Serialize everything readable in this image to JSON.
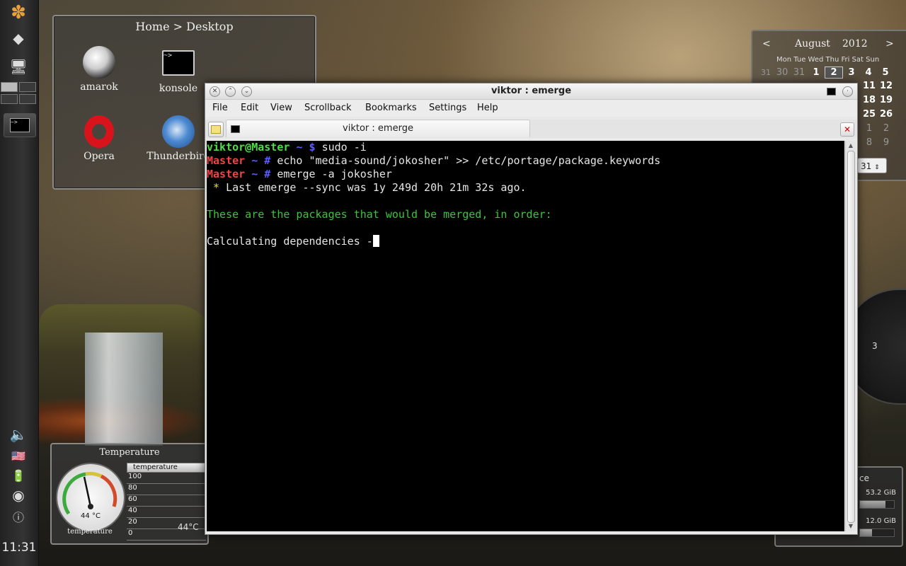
{
  "panel": {
    "clock": "11:31"
  },
  "folder_view": {
    "title": "Home > Desktop",
    "items": [
      {
        "label": "amarok"
      },
      {
        "label": "konsole"
      },
      {
        "label": "Opera"
      },
      {
        "label": "Thunderbird"
      }
    ]
  },
  "calendar": {
    "prev": "<",
    "next": ">",
    "month": "August",
    "year": "2012",
    "dows": "Mon Tue Wed Thu Fri Sat Sun",
    "row1": [
      "31",
      "30",
      "31",
      "1",
      "2",
      "3",
      "4",
      "5"
    ],
    "row_partial_1": [
      "18",
      "19"
    ],
    "row_partial_2": [
      "25",
      "26"
    ],
    "row_partial_3": [
      "1",
      "2"
    ],
    "row_partial_4": [
      "8",
      "9"
    ],
    "row_partial_0": [
      "11",
      "12"
    ],
    "spin_value": "31"
  },
  "analog_clock": {
    "hour_mark": "3"
  },
  "disk": {
    "label_partial": "ce",
    "size1": "53.2 GiB",
    "size2": "12.0 GiB",
    "fill1": 0.75,
    "fill2": 0.35
  },
  "temperature": {
    "title": "Temperature",
    "gauge_value": "44 °C",
    "gauge_name": "temperature",
    "table_header": "temperature",
    "scale": [
      "100",
      "80",
      "60",
      "40",
      "20",
      "0"
    ],
    "readout": "44°C"
  },
  "konsole": {
    "title": "viktor : emerge",
    "menu": [
      "File",
      "Edit",
      "View",
      "Scrollback",
      "Bookmarks",
      "Settings",
      "Help"
    ],
    "tab_label": "viktor : emerge",
    "lines": {
      "l1_user": "viktor@Master",
      "l1_path": " ~ $ ",
      "l1_cmd": "sudo -i",
      "l2_host": "Master",
      "l2_path": " ~ # ",
      "l2_cmd": "echo \"media-sound/jokosher\" >> /etc/portage/package.keywords",
      "l3_host": "Master",
      "l3_path": " ~ # ",
      "l3_cmd": "emerge -a jokosher",
      "l4_star": " * ",
      "l4_text": "Last emerge --sync was 1y 249d 20h 21m 32s ago.",
      "l6_text": "These are the packages that would be merged, in order:",
      "l8_text": "Calculating dependencies -"
    }
  }
}
